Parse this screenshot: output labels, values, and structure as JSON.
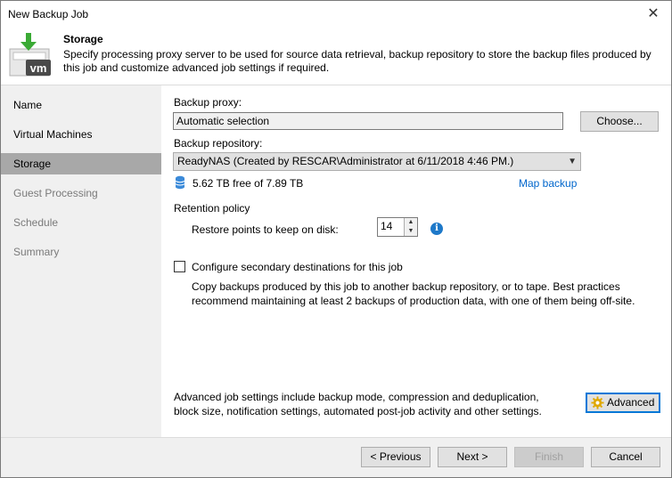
{
  "window": {
    "title": "New Backup Job"
  },
  "header": {
    "title": "Storage",
    "description": "Specify processing proxy server to be used for source data retrieval, backup repository to store the backup files produced by this job and customize advanced job settings if required.",
    "logo_text": "vm"
  },
  "sidebar": {
    "items": [
      {
        "label": "Name"
      },
      {
        "label": "Virtual Machines"
      },
      {
        "label": "Storage"
      },
      {
        "label": "Guest Processing"
      },
      {
        "label": "Schedule"
      },
      {
        "label": "Summary"
      }
    ]
  },
  "storage": {
    "proxy_label": "Backup proxy:",
    "proxy_value": "Automatic selection",
    "choose_label": "Choose...",
    "repo_label": "Backup repository:",
    "repo_value": "ReadyNAS (Created by RESCAR\\Administrator at 6/11/2018 4:46 PM.)",
    "free_space": "5.62 TB free of 7.89 TB",
    "map_backup": "Map backup",
    "retention_title": "Retention policy",
    "restore_points_label": "Restore points to keep on disk:",
    "restore_points_value": "14",
    "secondary_label": "Configure secondary destinations for this job",
    "secondary_desc_1": "Copy backups produced by this job to another backup repository, or to tape. Best practices",
    "secondary_desc_2": "recommend maintaining at least 2 backups of production data, with one of them being off-site.",
    "advanced_desc_1": "Advanced job settings include backup mode, compression and deduplication,",
    "advanced_desc_2": "block size, notification settings, automated post-job activity and other settings.",
    "advanced_label": "Advanced"
  },
  "footer": {
    "previous": "< Previous",
    "next": "Next >",
    "finish": "Finish",
    "cancel": "Cancel"
  },
  "colors": {
    "accent": "#0078d7",
    "link": "#0066cc",
    "active_nav": "#a8a8a8",
    "logo_green": "#3aaa35"
  }
}
